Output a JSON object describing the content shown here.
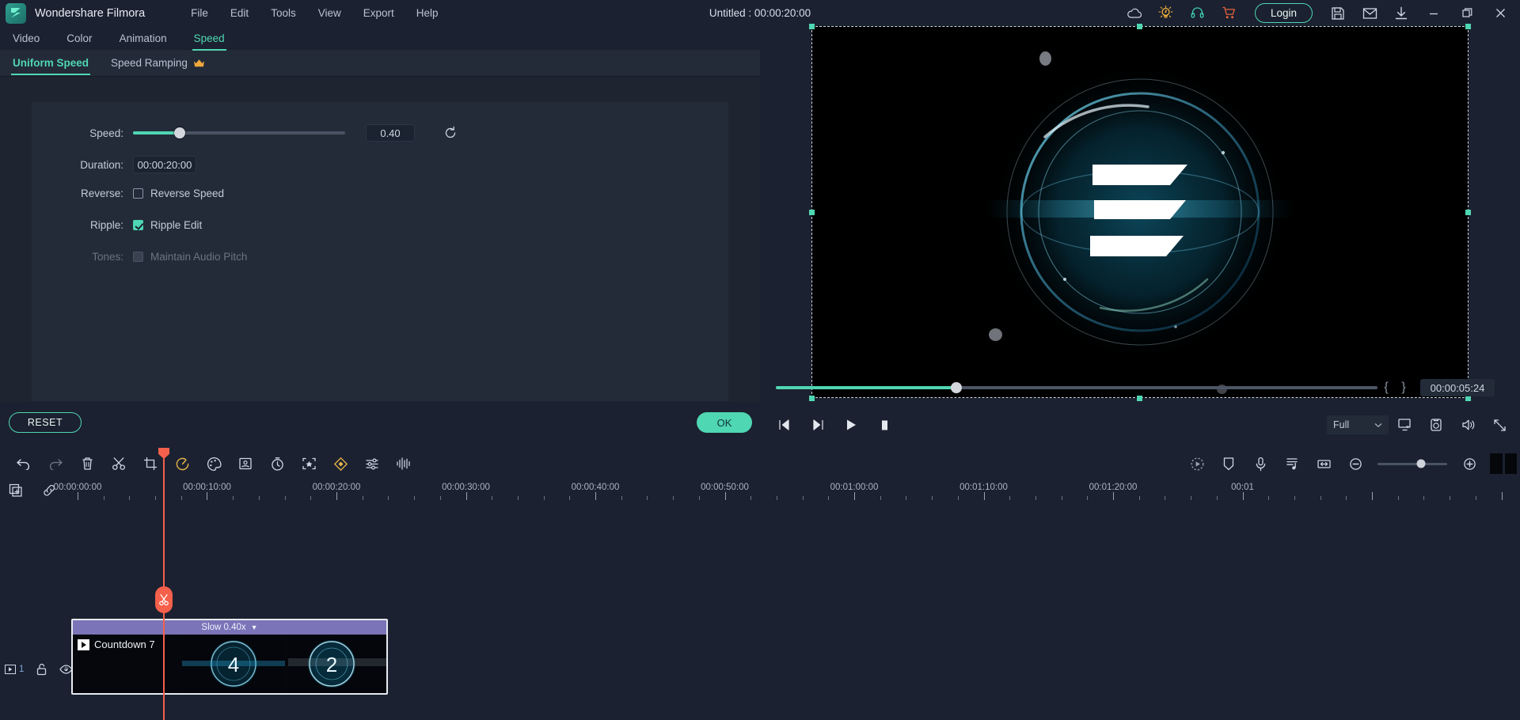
{
  "app": {
    "name": "Wondershare Filmora",
    "window_title": "Untitled : 00:00:20:00",
    "logo_icon": "filmora-logo-icon"
  },
  "menubar": {
    "items": [
      {
        "label": "File"
      },
      {
        "label": "Edit"
      },
      {
        "label": "Tools"
      },
      {
        "label": "View"
      },
      {
        "label": "Export"
      },
      {
        "label": "Help"
      }
    ]
  },
  "titlebar_right": {
    "icons": [
      {
        "name": "cloud-icon",
        "label": "Cloud"
      },
      {
        "name": "lightbulb-icon",
        "label": "Tips"
      },
      {
        "name": "headset-icon",
        "label": "Support"
      },
      {
        "name": "cart-icon",
        "label": "Store"
      }
    ],
    "login_label": "Login",
    "right_icons": [
      {
        "name": "save-icon",
        "label": "Save"
      },
      {
        "name": "mail-icon",
        "label": "Feedback"
      },
      {
        "name": "download-icon",
        "label": "Download"
      }
    ],
    "window_controls": [
      {
        "name": "minimize-button",
        "label": "Minimize"
      },
      {
        "name": "maximize-button",
        "label": "Maximize"
      },
      {
        "name": "close-button",
        "label": "Close"
      }
    ]
  },
  "panel": {
    "tabs": [
      {
        "label": "Video",
        "active": false
      },
      {
        "label": "Color",
        "active": false
      },
      {
        "label": "Animation",
        "active": false
      },
      {
        "label": "Speed",
        "active": true
      }
    ],
    "subtabs": [
      {
        "label": "Uniform Speed",
        "active": true,
        "badge": ""
      },
      {
        "label": "Speed Ramping",
        "active": false,
        "badge": "crown-icon"
      }
    ],
    "speed": {
      "label": "Speed:",
      "value": "0.40",
      "slider_percent": 22,
      "reset_icon": "reset-arrow-icon"
    },
    "duration": {
      "label": "Duration:",
      "value": "00:00:20:00"
    },
    "reverse": {
      "label": "Reverse:",
      "checkbox_label": "Reverse Speed",
      "checked": false
    },
    "ripple": {
      "label": "Ripple:",
      "checkbox_label": "Ripple Edit",
      "checked": true
    },
    "tones": {
      "label": "Tones:",
      "checkbox_label": "Maintain Audio Pitch",
      "checked": false,
      "disabled": true
    },
    "reset_button": "RESET",
    "ok_button": "OK"
  },
  "preview": {
    "scrub_percent": 30,
    "mark_in": "{",
    "mark_out": "}",
    "timecode": "00:00:05:24",
    "controls": [
      {
        "name": "prev-frame-button",
        "label": "Previous frame"
      },
      {
        "name": "next-frame-button",
        "label": "Next frame"
      },
      {
        "name": "play-button",
        "label": "Play"
      },
      {
        "name": "stop-button",
        "label": "Stop"
      }
    ],
    "quality_label": "Full",
    "right_icons": [
      {
        "name": "screen-fit-icon",
        "label": "Display settings"
      },
      {
        "name": "snapshot-icon",
        "label": "Snapshot"
      },
      {
        "name": "volume-icon",
        "label": "Volume"
      },
      {
        "name": "fullscreen-icon",
        "label": "Full screen"
      }
    ]
  },
  "toolbar": {
    "left_icons": [
      {
        "name": "undo-icon",
        "label": "Undo"
      },
      {
        "name": "redo-icon",
        "label": "Redo"
      },
      {
        "name": "delete-icon",
        "label": "Delete"
      },
      {
        "name": "split-icon",
        "label": "Split"
      },
      {
        "name": "crop-icon",
        "label": "Crop"
      },
      {
        "name": "speed-icon",
        "label": "Speed"
      },
      {
        "name": "color-palette-icon",
        "label": "Color"
      },
      {
        "name": "green-screen-icon",
        "label": "Green Screen"
      },
      {
        "name": "timer-icon",
        "label": "Freeze Frame"
      },
      {
        "name": "motion-tracking-icon",
        "label": "Motion Tracking"
      },
      {
        "name": "keyframe-icon",
        "label": "Keyframe"
      },
      {
        "name": "audio-mixer-icon",
        "label": "Audio Mixer"
      },
      {
        "name": "audio-waveform-icon",
        "label": "Audio Waveform"
      }
    ],
    "right_icons": [
      {
        "name": "render-preview-icon",
        "label": "Render Preview"
      },
      {
        "name": "marker-icon",
        "label": "Marker"
      },
      {
        "name": "voiceover-icon",
        "label": "Record Voiceover"
      },
      {
        "name": "detach-audio-icon",
        "label": "Detach Audio"
      },
      {
        "name": "fit-timeline-icon",
        "label": "Fit to Timeline"
      },
      {
        "name": "zoom-out-icon",
        "label": "Zoom Out"
      },
      {
        "name": "zoom-in-icon",
        "label": "Zoom In"
      }
    ],
    "zoom_percent": 62
  },
  "timeline": {
    "import_icon": "import-media-icon",
    "link_icon": "link-icon",
    "ruler_labels": [
      "00:00:00:00",
      "00:00:10:00",
      "00:00:20:00",
      "00:00:30:00",
      "00:00:40:00",
      "00:00:50:00",
      "00:01:00:00",
      "00:01:10:00",
      "00:01:20:00",
      "00:01"
    ],
    "track": {
      "number": "1",
      "lock_icon": "unlock-icon",
      "eye_icon": "eye-icon"
    },
    "clip": {
      "speed_badge": "Slow 0.40x",
      "badge_caret": "▼",
      "title": "Countdown 7",
      "thumb_labels": [
        "4",
        "2"
      ]
    },
    "split_button_icon": "scissors-icon"
  },
  "colors": {
    "accent": "#4fd6b2",
    "playhead": "#f4604b",
    "clip_badge": "#7b74b8",
    "panel_bg": "#232b39",
    "app_bg": "#1b2130"
  }
}
